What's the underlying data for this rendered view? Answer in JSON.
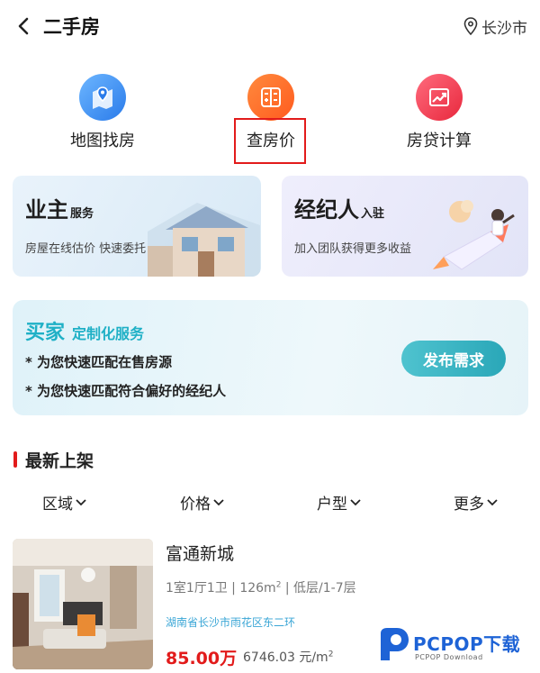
{
  "header": {
    "title": "二手房",
    "city": "长沙市",
    "back_icon": "back-arrow-icon",
    "location_icon": "location-pin-icon"
  },
  "tools": [
    {
      "label": "地图找房",
      "icon": "map-pin-icon",
      "color": "#2a7bea"
    },
    {
      "label": "查房价",
      "icon": "price-list-icon",
      "color": "#ff5b1f"
    },
    {
      "label": "房贷计算",
      "icon": "trend-chart-icon",
      "color": "#e8283d"
    }
  ],
  "cards": {
    "owner": {
      "title": "业主",
      "suffix": "服务",
      "subtitle": "房屋在线估价 快速委托"
    },
    "agent": {
      "title": "经纪人",
      "suffix": "入驻",
      "subtitle": "加入团队获得更多收益"
    }
  },
  "buyer": {
    "title": "买家",
    "subtitle": "定制化服务",
    "line1": "* 为您快速匹配在售房源",
    "line2": "* 为您快速匹配符合偏好的经纪人",
    "button": "发布需求"
  },
  "section": {
    "title": "最新上架"
  },
  "filters": [
    "区域",
    "价格",
    "户型",
    "更多"
  ],
  "listing": {
    "title": "富通新城",
    "meta_pre": "1室1厅1卫 | 126m",
    "meta_sup": "2",
    "meta_post": " | 低层/1-7层",
    "address": "湖南省长沙市雨花区东二环",
    "price": "85.00万",
    "unit_price": "6746.03 元/m",
    "unit_sup": "2"
  },
  "watermark": {
    "brand": "PCPOP下载",
    "sub": "PCPOP Download"
  },
  "colors": {
    "accent_red": "#e21b1b",
    "teal": "#2aa7b8",
    "link_blue": "#3aa6d6"
  }
}
